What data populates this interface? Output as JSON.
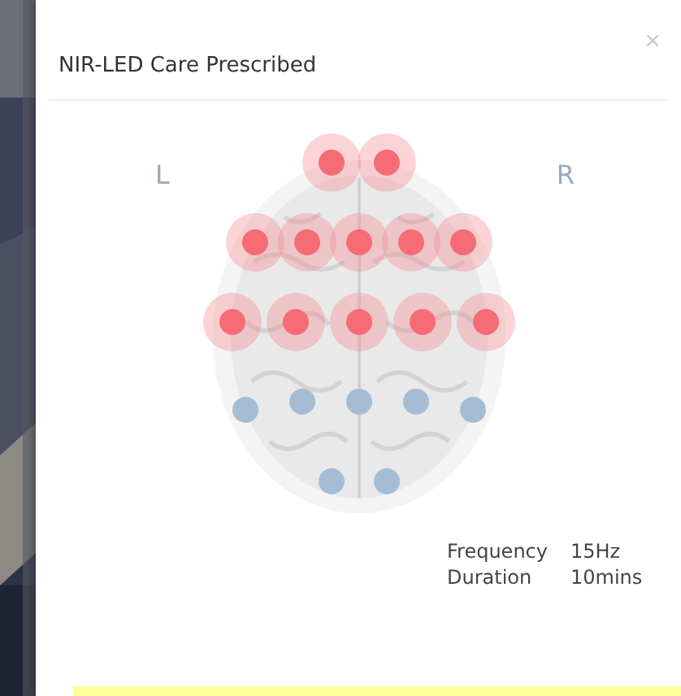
{
  "dialog": {
    "title": "NIR-LED Care Prescribed",
    "close": "×"
  },
  "side_labels": {
    "left": "L",
    "right": "R"
  },
  "led_rows": [
    [
      {
        "on": true
      },
      {
        "on": true
      }
    ],
    [
      {
        "on": true
      },
      {
        "on": true
      },
      {
        "on": true
      },
      {
        "on": true
      },
      {
        "on": true
      }
    ],
    [
      {
        "on": true
      },
      {
        "on": true
      },
      {
        "on": true
      },
      {
        "on": true
      },
      {
        "on": true
      }
    ],
    [
      {
        "on": false
      },
      {
        "on": false
      },
      {
        "on": false
      },
      {
        "on": false
      },
      {
        "on": false
      }
    ],
    [
      {
        "on": false
      },
      {
        "on": false
      }
    ]
  ],
  "settings": [
    {
      "label": "Frequency",
      "value": "15Hz"
    },
    {
      "label": "Duration",
      "value": "10mins"
    }
  ]
}
